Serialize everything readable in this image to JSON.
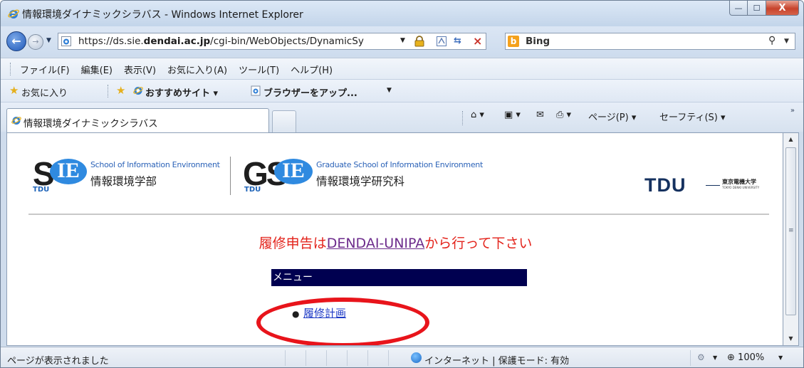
{
  "window": {
    "title": "情報環境ダイナミックシラバス - Windows Internet Explorer",
    "minimize_glyph": "—",
    "maximize_glyph": "☐",
    "close_glyph": "X"
  },
  "address_bar": {
    "url_prefix": "https://ds.sie.",
    "url_host": "dendai.ac.jp",
    "url_suffix": "/cgi-bin/WebObjects/DynamicSy"
  },
  "search": {
    "provider": "Bing",
    "icon": "magnifier-icon"
  },
  "menu_bar": {
    "items": [
      "ファイル(F)",
      "編集(E)",
      "表示(V)",
      "お気に入り(A)",
      "ツール(T)",
      "ヘルプ(H)"
    ]
  },
  "favorites_bar": {
    "favorites_label": "お気に入り",
    "suggested_sites": "おすすめサイト ▾",
    "upgrade_browser": "ブラウザーをアップ..."
  },
  "tabs": {
    "active_title": "情報環境ダイナミックシラバス"
  },
  "command_bar": {
    "page": "ページ(P) ▾",
    "safety": "セーフティ(S) ▾"
  },
  "page": {
    "sie": {
      "mark": "S",
      "mark_circle": "IE",
      "mark_sub": "TDU",
      "name_en": "School of Information Environment",
      "name_jp": "情報環境学部"
    },
    "gsie": {
      "mark": "GS",
      "mark_circle": "IE",
      "mark_sub": "TDU",
      "name_en": "Graduate School of Information Environment",
      "name_jp": "情報環境学研究科"
    },
    "tdu": {
      "mark": "TDU",
      "name_jp": "東京電機大学",
      "name_en": "TOKYO DENKI UNIVERSITY"
    },
    "notice_prefix": "履修申告は",
    "notice_link": "DENDAI-UNIPA",
    "notice_suffix": "から行って下さい",
    "menu_title": "メニュー",
    "menu_items": [
      "履修計画"
    ]
  },
  "status_bar": {
    "message": "ページが表示されました",
    "zone": "インターネット | 保護モード: 有効",
    "zoom": "100%"
  },
  "colors": {
    "notice_red": "#e3231b",
    "menu_header_bg": "#000050",
    "link_blue": "#1c39c6",
    "highlight_ellipse": "#e8141b"
  }
}
